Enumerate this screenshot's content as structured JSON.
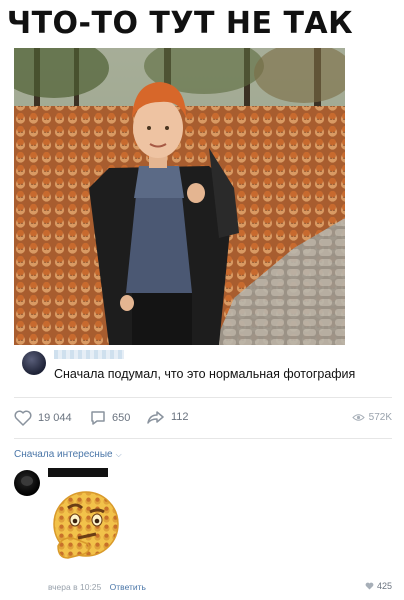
{
  "meme": {
    "title": "ЧТО-ТО ТУТ НЕ ТАК"
  },
  "post": {
    "caption": "Сначала подумал, что это нормальная фотография",
    "likes": "19 044",
    "comments": "650",
    "shares": "112",
    "views": "572K"
  },
  "comments_section": {
    "sort_label": "Сначала интересные"
  },
  "comment": {
    "time": "вчера в 10:25",
    "reply_label": "Ответить",
    "likes": "425"
  },
  "colors": {
    "accent": "#4a76a8",
    "meta": "#9aa3ad",
    "leaves": "#b0673a"
  },
  "icons": {
    "like": "heart-icon",
    "comment": "comment-icon",
    "share": "share-arrow-icon",
    "views": "eye-icon",
    "sort": "chevron-down-icon"
  }
}
